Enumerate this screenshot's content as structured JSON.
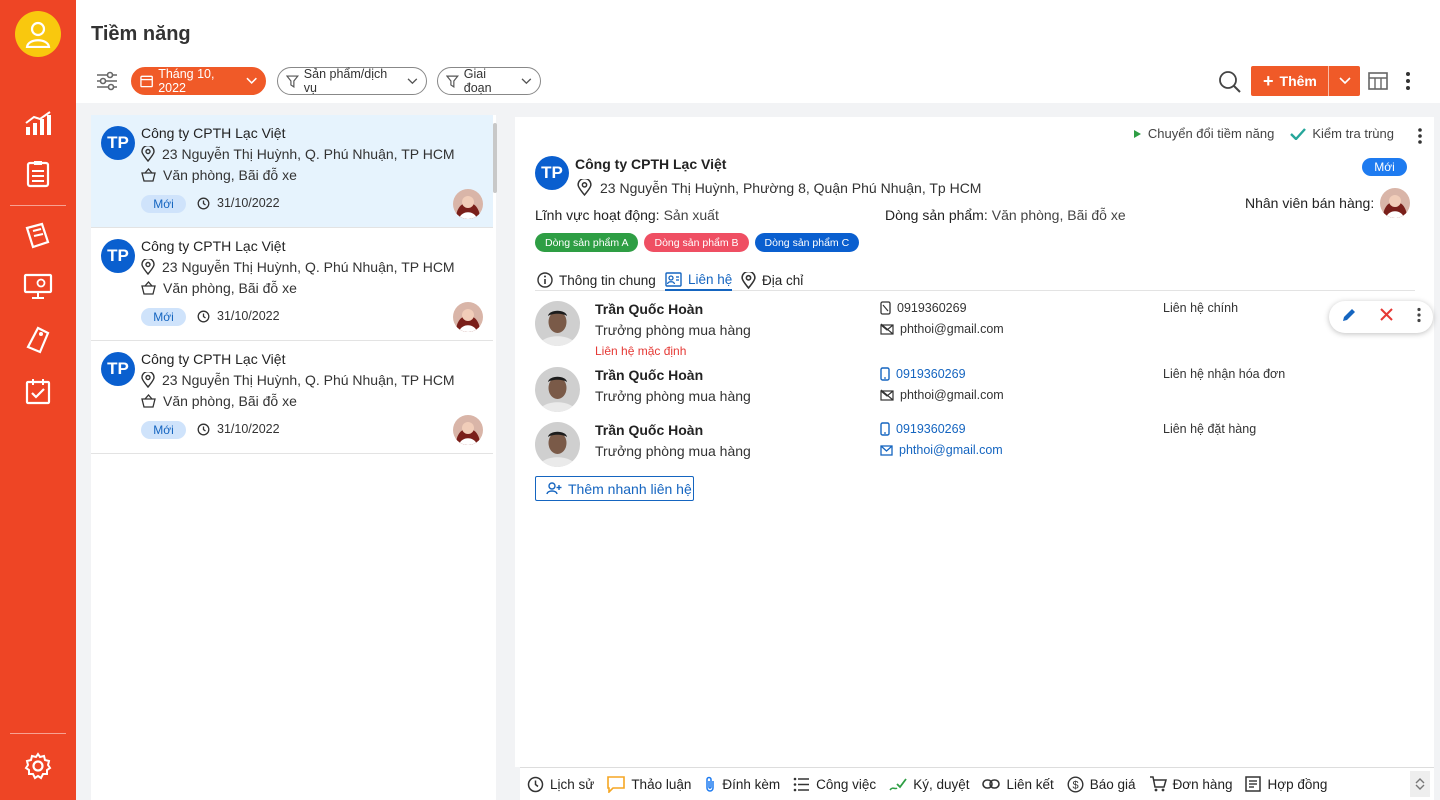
{
  "page": {
    "title": "Tiềm năng"
  },
  "toolbar": {
    "month_filter": "Tháng 10, 2022",
    "product_filter": "Sản phẩm/dịch vụ",
    "stage_filter": "Giai đoạn",
    "add_label": "Thêm"
  },
  "list": {
    "items": [
      {
        "initials": "TP",
        "name": "Công ty CPTH Lạc Việt",
        "address": "23 Nguyễn Thị Huỳnh, Q. Phú Nhuận, TP HCM",
        "products": "Văn phòng, Bãi đỗ xe",
        "status": "Mới",
        "date": "31/10/2022"
      },
      {
        "initials": "TP",
        "name": "Công ty CPTH Lạc Việt",
        "address": "23 Nguyễn Thị Huỳnh, Q. Phú Nhuận, TP HCM",
        "products": "Văn phòng, Bãi đỗ xe",
        "status": "Mới",
        "date": "31/10/2022"
      },
      {
        "initials": "TP",
        "name": "Công ty CPTH Lạc Việt",
        "address": "23 Nguyễn Thị Huỳnh, Q. Phú Nhuận, TP HCM",
        "products": "Văn phòng, Bãi đỗ xe",
        "status": "Mới",
        "date": "31/10/2022"
      }
    ]
  },
  "detail": {
    "actions": {
      "convert": "Chuyển đổi tiềm năng",
      "check_dup": "Kiểm tra trùng"
    },
    "initials": "TP",
    "name": "Công ty CPTH Lạc Việt",
    "address": "23 Nguyễn Thị Huỳnh, Phường 8, Quận Phú Nhuận, Tp HCM",
    "status": "Mới",
    "sales_label": "Nhân viên bán hàng:",
    "field_label": "Lĩnh vực hoạt động:",
    "field_value": "Sản xuất",
    "product_line_label": "Dòng sản phẩm:",
    "product_line_value": "Văn phòng, Bãi đỗ xe",
    "tags": [
      {
        "label": "Dòng sản phẩm A",
        "color": "#2e9e44"
      },
      {
        "label": "Dòng sản phẩm B",
        "color": "#ef4f63"
      },
      {
        "label": "Dòng sản phẩm C",
        "color": "#0a5fcf"
      }
    ],
    "tabs": {
      "general": "Thông tin chung",
      "contacts": "Liên hệ",
      "address": "Địa chỉ"
    },
    "contacts": [
      {
        "name": "Trần Quốc Hoàn",
        "title": "Trưởng phòng mua hàng",
        "default_label": "Liên hệ mặc định",
        "phone": "0919360269",
        "email": "phthoi@gmail.com",
        "role": "Liên hệ chính"
      },
      {
        "name": "Trần Quốc Hoàn",
        "title": "Trưởng phòng mua hàng",
        "phone": "0919360269",
        "email": "phthoi@gmail.com",
        "role": "Liên hệ nhận hóa đơn"
      },
      {
        "name": "Trần Quốc Hoàn",
        "title": "Trưởng phòng mua hàng",
        "phone": "0919360269",
        "email": "phthoi@gmail.com",
        "role": "Liên hệ đặt hàng"
      }
    ],
    "quick_add": "Thêm nhanh liên hệ"
  },
  "bottom_bar": {
    "history": "Lịch sử",
    "discussion": "Thảo luận",
    "attachments": "Đính kèm",
    "tasks": "Công việc",
    "approval": "Ký, duyệt",
    "links": "Liên kết",
    "quotes": "Báo giá",
    "orders": "Đơn hàng",
    "contracts": "Hợp đồng"
  },
  "colors": {
    "brand": "#ee4525",
    "accent": "#f05a28",
    "primary_blue": "#0a5fcf"
  }
}
